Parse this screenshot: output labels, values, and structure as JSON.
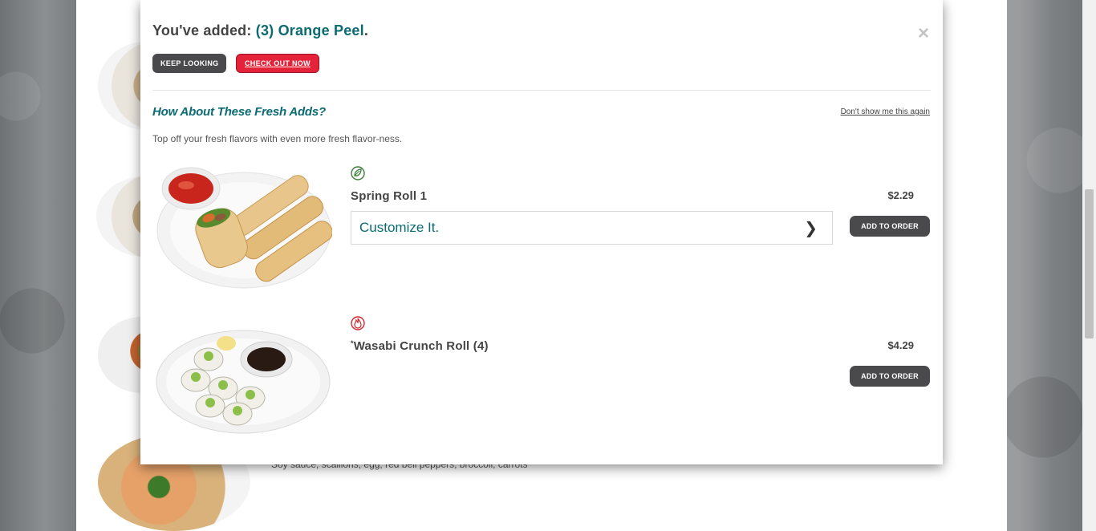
{
  "background": {
    "description_text": "Soy sauce, scallions, egg, red bell peppers, broccoli, carrots"
  },
  "modal": {
    "added_prefix": "You've added: ",
    "added_item": "(3) Orange Peel",
    "added_suffix": ".",
    "close_symbol": "×",
    "keep_looking_label": "KEEP LOOKING",
    "check_out_label": "CHECK OUT NOW",
    "section_title": "How About These Fresh Adds?",
    "dont_show_label": "Don't show me this again",
    "section_subtitle": "Top off your fresh flavors with even more fresh flavor-ness.",
    "items": [
      {
        "name": "Spring Roll 1",
        "price": "$2.29",
        "badge_icon": "leaf-icon",
        "badge_color": "#3f7d3a",
        "customize_label": "Customize It.",
        "customize_chevron": "❯",
        "add_label": "ADD TO ORDER"
      },
      {
        "asterisk": "*",
        "name": "Wasabi Crunch Roll (4)",
        "price": "$4.29",
        "badge_icon": "flame-icon",
        "badge_color": "#d8232f",
        "add_label": "ADD TO ORDER"
      }
    ]
  },
  "colors": {
    "accent_teal": "#0b6b73",
    "checkout_red": "#e4223a",
    "button_dark": "#4a4a4c"
  }
}
